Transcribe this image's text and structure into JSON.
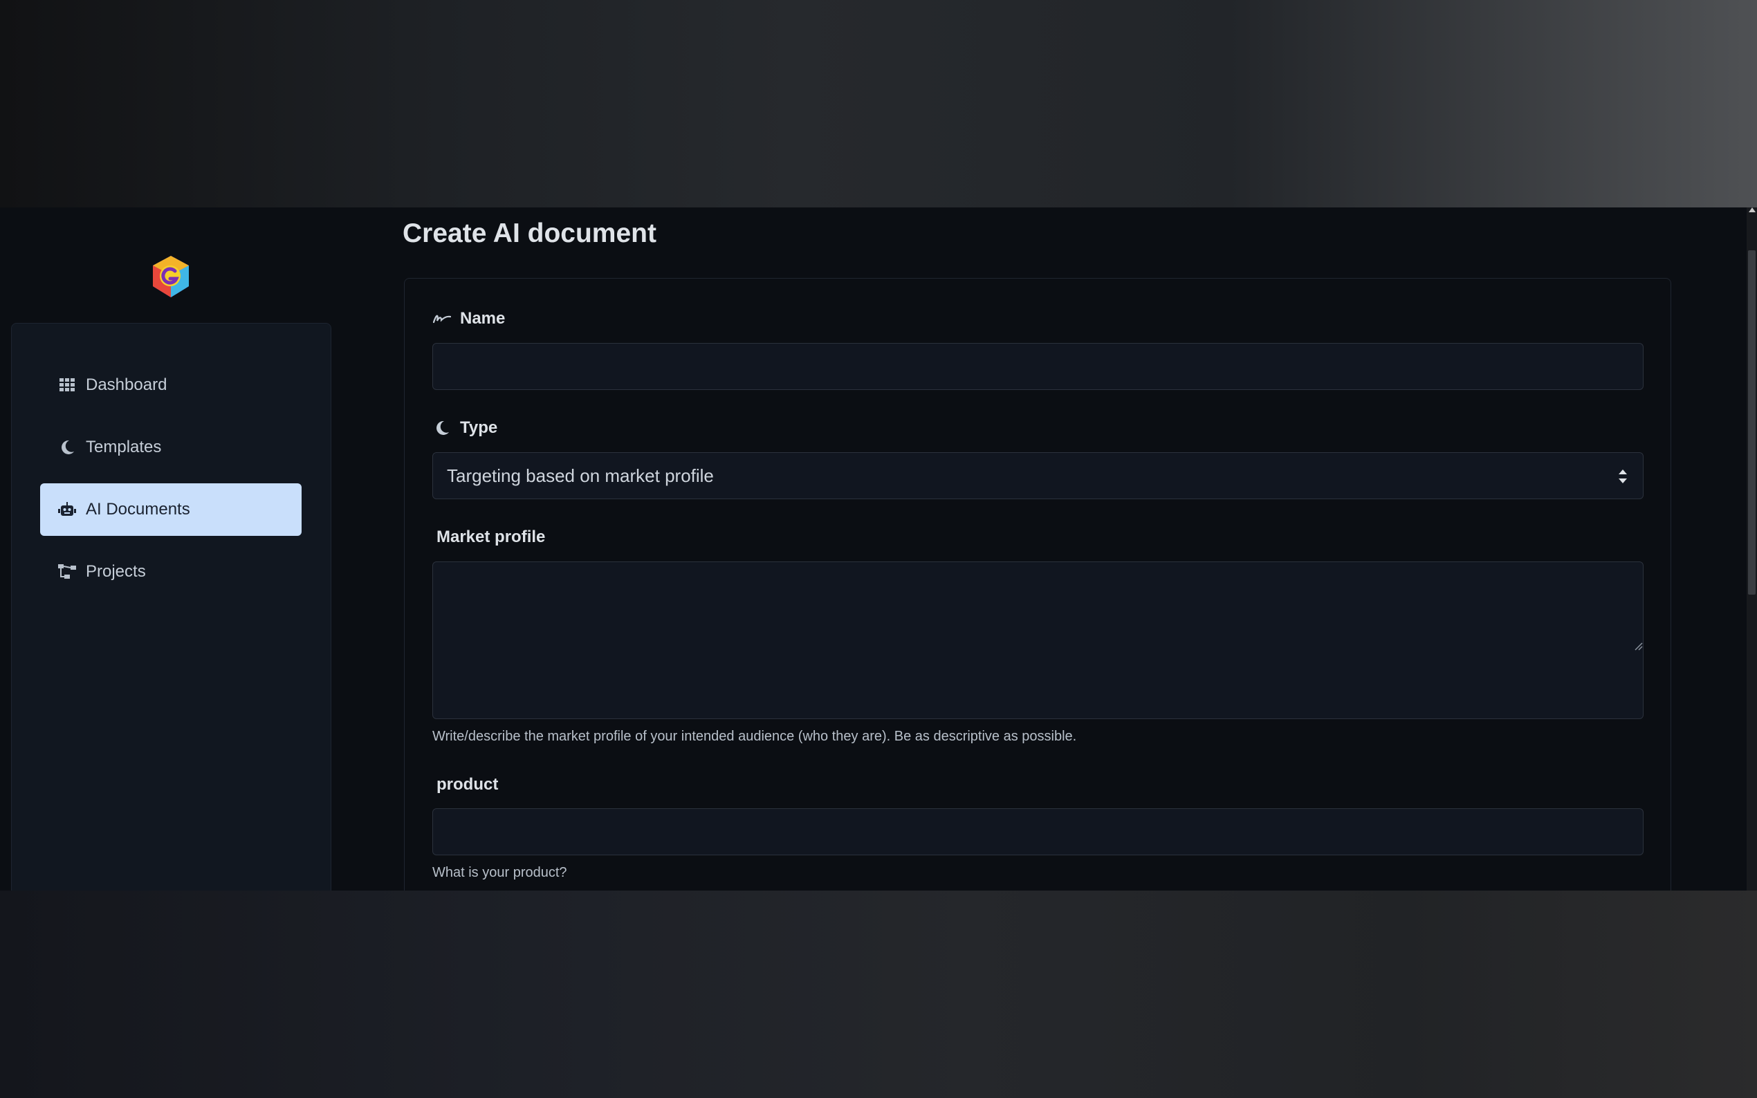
{
  "page": {
    "title": "Create AI document"
  },
  "sidebar": {
    "items": [
      {
        "label": "Dashboard",
        "icon": "grid-icon",
        "active": false
      },
      {
        "label": "Templates",
        "icon": "moon-icon",
        "active": false
      },
      {
        "label": "AI Documents",
        "icon": "robot-icon",
        "active": true
      },
      {
        "label": "Projects",
        "icon": "sitemap-icon",
        "active": false
      }
    ]
  },
  "form": {
    "name": {
      "label": "Name",
      "icon": "signature-icon",
      "value": ""
    },
    "type": {
      "label": "Type",
      "icon": "moon-icon",
      "selected": "Targeting based on market profile"
    },
    "market_profile": {
      "label": "Market profile",
      "value": "",
      "help": "Write/describe the market profile of your intended audience (who they are). Be as descriptive as possible."
    },
    "product": {
      "label": "product",
      "value": "",
      "help": "What is your product?"
    }
  },
  "colors": {
    "background": "#0b0e13",
    "sidebar": "#111720",
    "active_item": "#c9dffb",
    "input_bg": "#111620",
    "input_border": "#2b313c",
    "text": "#dfe3e8"
  }
}
